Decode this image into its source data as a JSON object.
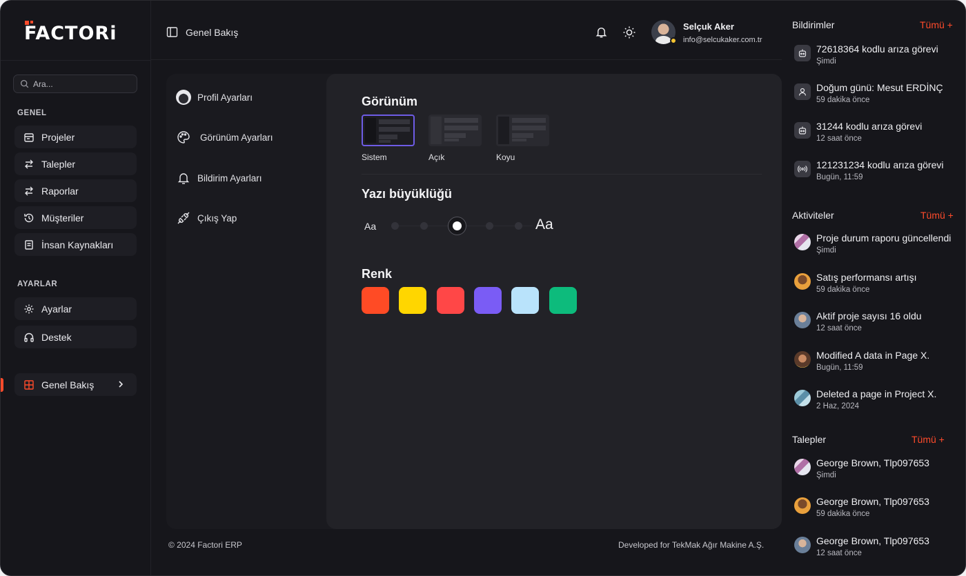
{
  "app": {
    "brand": "FACTORi",
    "accent_color": "#ff4b2b"
  },
  "sidebar": {
    "search_placeholder": "Ara...",
    "section_general": "GENEL",
    "general_items": [
      {
        "label": "Projeler",
        "icon": "calendar-icon"
      },
      {
        "label": "Talepler",
        "icon": "arrows-swap-icon"
      },
      {
        "label": "Raporlar",
        "icon": "arrows-swap-icon"
      },
      {
        "label": "Müşteriler",
        "icon": "history-icon"
      },
      {
        "label": "İnsan Kaynakları",
        "icon": "document-icon"
      }
    ],
    "section_settings": "AYARLAR",
    "settings_items": [
      {
        "label": "Ayarlar",
        "icon": "gear-icon"
      },
      {
        "label": "Destek",
        "icon": "headphones-icon"
      }
    ],
    "overview_item": {
      "label": "Genel Bakış",
      "icon": "grid-icon"
    }
  },
  "header": {
    "title": "Genel Bakış",
    "user_name": "Selçuk Aker",
    "user_email": "info@selcukaker.com.tr"
  },
  "settings_menu": [
    {
      "label": "Profil Ayarları",
      "icon": "profile-avatar-icon"
    },
    {
      "label": "Görünüm Ayarları",
      "icon": "palette-icon"
    },
    {
      "label": "Bildirim Ayarları",
      "icon": "bell-icon"
    },
    {
      "label": "Çıkış Yap",
      "icon": "plug-icon"
    }
  ],
  "appearance": {
    "title": "Görünüm",
    "themes": [
      "Sistem",
      "Açık",
      "Koyu"
    ],
    "selected_theme": "Sistem",
    "font_size_title": "Yazı büyüklüğü",
    "font_small_label": "Aa",
    "font_large_label": "Aa",
    "font_size_steps": 6,
    "font_size_selected_index": 2,
    "color_title": "Renk",
    "colors": [
      "#ff4b25",
      "#ffd600",
      "#ff4747",
      "#7a5cf5",
      "#b9e3fb",
      "#0dbb7c"
    ]
  },
  "footer": {
    "copyright": "© 2024 Factori ERP",
    "developed": "Developed for TekMak Ağır Makine A.Ş."
  },
  "notifications": {
    "title": "Bildirimler",
    "all_label": "Tümü +",
    "items": [
      {
        "text": "72618364 kodlu arıza görevi",
        "time": "Şimdi",
        "icon": "robot-icon"
      },
      {
        "text": "Doğum günü: Mesut ERDİNÇ",
        "time": "59 dakika önce",
        "icon": "user-icon"
      },
      {
        "text": "31244 kodlu arıza görevi",
        "time": "12 saat önce",
        "icon": "robot-icon"
      },
      {
        "text": "121231234 kodlu arıza görevi",
        "time": "Bugün, 11:59",
        "icon": "broadcast-icon"
      }
    ]
  },
  "activities": {
    "title": "Aktiviteler",
    "all_label": "Tümü +",
    "items": [
      {
        "text": "Proje durum raporu güncellendi",
        "time": "Şimdi"
      },
      {
        "text": "Satış performansı artışı",
        "time": "59 dakika önce"
      },
      {
        "text": "Aktif proje sayısı 16 oldu",
        "time": "12 saat önce"
      },
      {
        "text": "Modified A data in Page X.",
        "time": "Bugün, 11:59"
      },
      {
        "text": "Deleted a page in Project X.",
        "time": "2 Haz, 2024"
      }
    ]
  },
  "requests": {
    "title": "Talepler",
    "all_label": "Tümü +",
    "items": [
      {
        "text": "George Brown, Tlp097653",
        "time": "Şimdi"
      },
      {
        "text": "George Brown, Tlp097653",
        "time": "59 dakika önce"
      },
      {
        "text": "George Brown, Tlp097653",
        "time": "12 saat önce"
      }
    ]
  }
}
